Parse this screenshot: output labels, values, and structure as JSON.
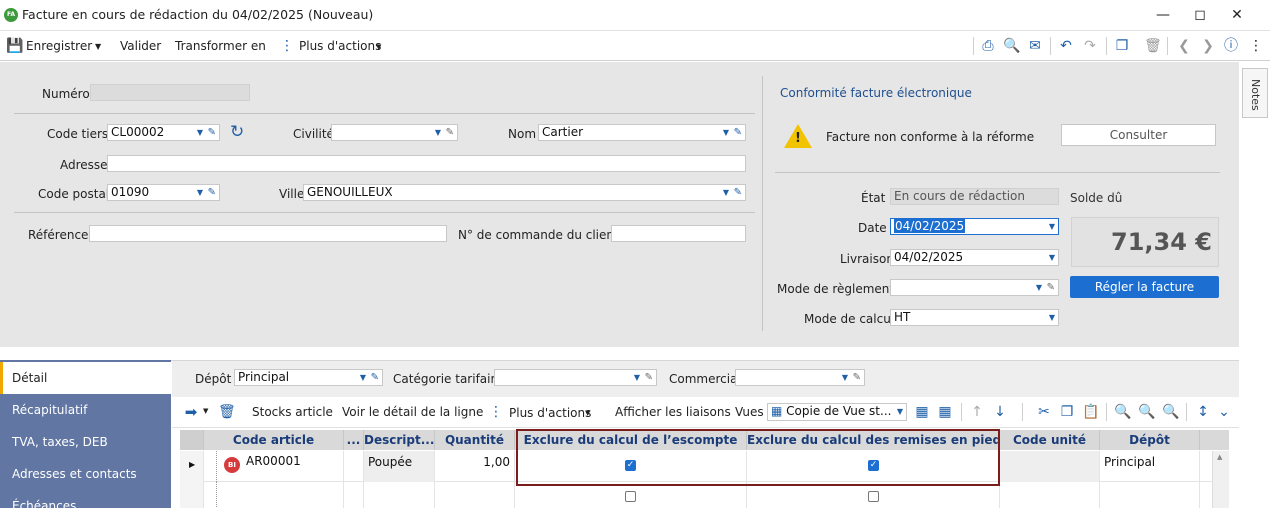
{
  "window": {
    "app_badge": "FA",
    "title": "Facture en cours de rédaction du 04/02/2025 (Nouveau)"
  },
  "toolbar": {
    "save_label": "Enregistrer",
    "validate_label": "Valider",
    "transform_label": "Transformer en",
    "more_actions_label": "Plus d'actions"
  },
  "form": {
    "numero_label": "Numéro",
    "numero_value": "",
    "code_tiers_label": "Code tiers",
    "code_tiers_value": "CL00002",
    "civilite_label": "Civilité",
    "civilite_value": "",
    "nom_label": "Nom",
    "nom_value": "Cartier",
    "adresse_label": "Adresse",
    "adresse_value": "",
    "code_postal_label": "Code postal",
    "code_postal_value": "01090",
    "ville_label": "Ville",
    "ville_value": "GENOUILLEUX",
    "reference_label": "Référence",
    "reference_value": "",
    "commande_label": "N° de commande du client",
    "commande_value": ""
  },
  "conformity": {
    "section_title": "Conformité facture électronique",
    "warning_text": "Facture non conforme à la réforme",
    "consult_label": "Consulter"
  },
  "status": {
    "etat_label": "État",
    "etat_value": "En cours de rédaction",
    "date_label": "Date",
    "date_value": "04/02/2025",
    "livraison_label": "Livraison",
    "livraison_value": "04/02/2025",
    "mode_reglement_label": "Mode de règlement",
    "mode_reglement_value": "",
    "mode_calcul_label": "Mode de calcul",
    "mode_calcul_value": "HT",
    "solde_label": "Solde dû",
    "solde_value": "71,34 €",
    "pay_label": "Régler la facture"
  },
  "notes_tab": "Notes",
  "sidebar": {
    "items": [
      {
        "label": "Détail",
        "active": true
      },
      {
        "label": "Récapitulatif",
        "active": false
      },
      {
        "label": "TVA, taxes, DEB",
        "active": false
      },
      {
        "label": "Adresses et contacts",
        "active": false
      },
      {
        "label": "Échéances",
        "active": false
      }
    ]
  },
  "filters": {
    "depot_label": "Dépôt",
    "depot_value": "Principal",
    "categorie_label": "Catégorie tarifaire",
    "categorie_value": "",
    "commercial_label": "Commercial",
    "commercial_value": ""
  },
  "grid_toolbar": {
    "stocks_label": "Stocks article",
    "detail_label": "Voir le détail de la ligne",
    "more_actions_label": "Plus d'actions",
    "liaisons_label": "Afficher les liaisons",
    "vues_label": "Vues",
    "vue_value": "Copie de Vue st..."
  },
  "grid": {
    "columns": [
      "Code article",
      "...",
      "Descript...",
      "Quantité",
      "Exclure du calcul de l’escompte",
      "Exclure du calcul des remises en pied",
      "Code unité",
      "Dépôt"
    ],
    "rows": [
      {
        "badge": "BI",
        "code_article": "AR00001",
        "description": "Poupée",
        "quantite": "1,00",
        "exclure_escompte": true,
        "exclure_remises": true,
        "code_unite": "",
        "depot": "Principal"
      },
      {
        "badge": "",
        "code_article": "",
        "description": "",
        "quantite": "",
        "exclure_escompte": false,
        "exclure_remises": false,
        "code_unite": "",
        "depot": ""
      }
    ]
  },
  "colors": {
    "accent_blue": "#1c6fd1",
    "sidebar_bg": "#6176a3",
    "header_text": "#1a3d7a",
    "highlight_border": "#7a1d1d",
    "warning_yellow": "#f2c300"
  }
}
